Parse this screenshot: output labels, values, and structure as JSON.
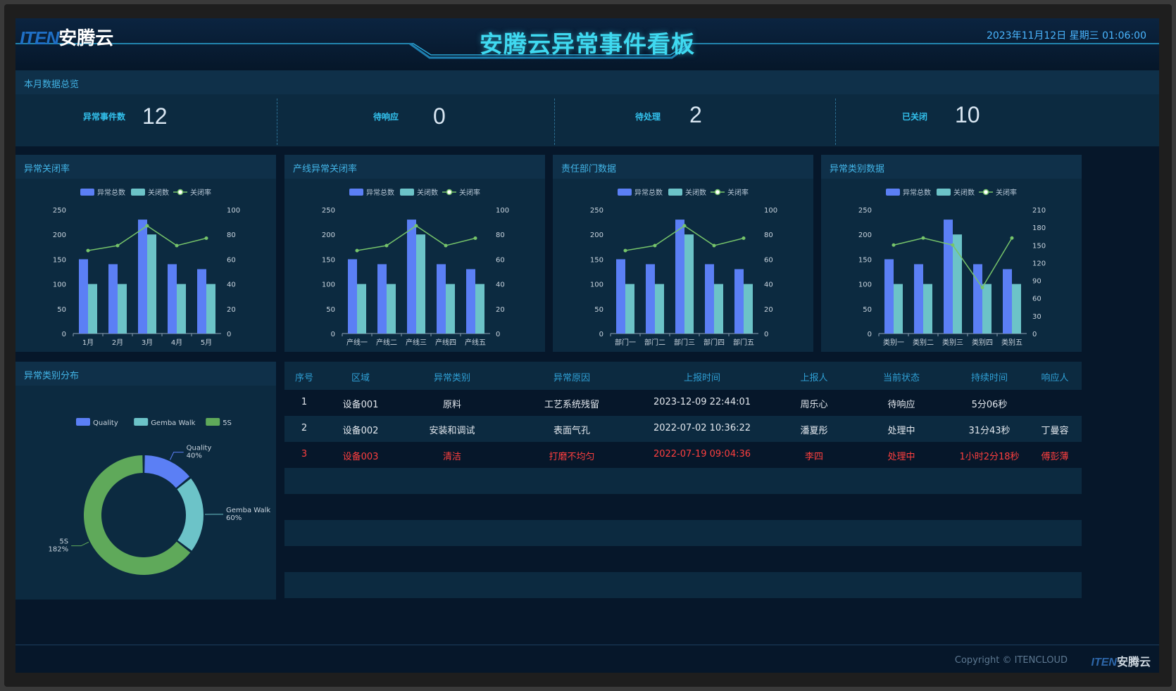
{
  "header": {
    "logo_mark": "ITEN",
    "logo_text": "安腾云",
    "title": "安腾云异常事件看板",
    "datetime": "2023年11月12日  星期三   01:06:00"
  },
  "overview": {
    "title": "本月数据总览",
    "kpis": [
      {
        "label": "异常事件数",
        "value": "12"
      },
      {
        "label": "待响应",
        "value": "0"
      },
      {
        "label": "待处理",
        "value": "2"
      },
      {
        "label": "已关闭",
        "value": "10"
      }
    ]
  },
  "legend_labels": {
    "total": "异常总数",
    "closed": "关闭数",
    "rate": "关闭率"
  },
  "colors": {
    "total": "#5b7ff5",
    "closed": "#6cc3c8",
    "rate": "#76c46a",
    "accent": "#3fd9f0",
    "alert": "#ff3f3f"
  },
  "chart_data": [
    {
      "panel_title": "异常关闭率",
      "type": "bar",
      "categories": [
        "1月",
        "2月",
        "3月",
        "4月",
        "5月"
      ],
      "series": [
        {
          "name": "异常总数",
          "type": "bar",
          "values": [
            150,
            140,
            230,
            140,
            130
          ]
        },
        {
          "name": "关闭数",
          "type": "bar",
          "values": [
            100,
            100,
            200,
            100,
            100
          ]
        },
        {
          "name": "关闭率",
          "type": "line",
          "axis": "right",
          "values": [
            67,
            71,
            87,
            71,
            77
          ]
        }
      ],
      "y_left_ticks": [
        0,
        50,
        100,
        150,
        200,
        250
      ],
      "y_right_ticks": [
        0,
        20,
        40,
        60,
        80,
        100
      ],
      "ylim_left": [
        0,
        250
      ],
      "ylim_right": [
        0,
        100
      ]
    },
    {
      "panel_title": "产线异常关闭率",
      "type": "bar",
      "categories": [
        "产线一",
        "产线二",
        "产线三",
        "产线四",
        "产线五"
      ],
      "series": [
        {
          "name": "异常总数",
          "type": "bar",
          "values": [
            150,
            140,
            230,
            140,
            130
          ]
        },
        {
          "name": "关闭数",
          "type": "bar",
          "values": [
            100,
            100,
            200,
            100,
            100
          ]
        },
        {
          "name": "关闭率",
          "type": "line",
          "axis": "right",
          "values": [
            67,
            71,
            87,
            71,
            77
          ]
        }
      ],
      "y_left_ticks": [
        0,
        50,
        100,
        150,
        200,
        250
      ],
      "y_right_ticks": [
        0,
        20,
        40,
        60,
        80,
        100
      ],
      "ylim_left": [
        0,
        250
      ],
      "ylim_right": [
        0,
        100
      ]
    },
    {
      "panel_title": "责任部门数据",
      "type": "bar",
      "categories": [
        "部门一",
        "部门二",
        "部门三",
        "部门四",
        "部门五"
      ],
      "series": [
        {
          "name": "异常总数",
          "type": "bar",
          "values": [
            150,
            140,
            230,
            140,
            130
          ]
        },
        {
          "name": "关闭数",
          "type": "bar",
          "values": [
            100,
            100,
            200,
            100,
            100
          ]
        },
        {
          "name": "关闭率",
          "type": "line",
          "axis": "right",
          "values": [
            67,
            71,
            87,
            71,
            77
          ]
        }
      ],
      "y_left_ticks": [
        0,
        50,
        100,
        150,
        200,
        250
      ],
      "y_right_ticks": [
        0,
        20,
        40,
        60,
        80,
        100
      ],
      "ylim_left": [
        0,
        250
      ],
      "ylim_right": [
        0,
        100
      ]
    },
    {
      "panel_title": "异常类别数据",
      "type": "bar",
      "categories": [
        "类别一",
        "类别二",
        "类别三",
        "类别四",
        "类别五"
      ],
      "series": [
        {
          "name": "异常总数",
          "type": "bar",
          "values": [
            150,
            140,
            230,
            140,
            130
          ]
        },
        {
          "name": "关闭数",
          "type": "bar",
          "values": [
            100,
            100,
            200,
            100,
            100
          ]
        },
        {
          "name": "关闭率",
          "type": "line",
          "axis": "right",
          "values": [
            150,
            162,
            150,
            78,
            162
          ]
        }
      ],
      "y_left_ticks": [
        0,
        50,
        100,
        150,
        200,
        250
      ],
      "y_right_ticks": [
        0,
        30,
        60,
        90,
        120,
        150,
        180,
        210
      ],
      "ylim_left": [
        0,
        250
      ],
      "ylim_right": [
        0,
        210
      ]
    },
    {
      "panel_title": "异常类别分布",
      "type": "pie",
      "slices": [
        {
          "name": "Quality",
          "value": 40,
          "label": "40%",
          "color": "#5b7ff5"
        },
        {
          "name": "Gemba Walk",
          "value": 60,
          "label": "60%",
          "color": "#6cc3c8"
        },
        {
          "name": "5S",
          "value": 182,
          "label": "182%",
          "color": "#5fa95a"
        }
      ]
    }
  ],
  "table": {
    "headers": [
      "序号",
      "区域",
      "异常类别",
      "异常原因",
      "上报时间",
      "上报人",
      "当前状态",
      "持续时间",
      "响应人"
    ],
    "rows": [
      {
        "alert": false,
        "cells": [
          "1",
          "设备001",
          "原料",
          "工艺系统残留",
          "2023-12-09 22:44:01",
          "周乐心",
          "待响应",
          "5分06秒",
          ""
        ]
      },
      {
        "alert": false,
        "cells": [
          "2",
          "设备002",
          "安装和调试",
          "表面气孔",
          "2022-07-02 10:36:22",
          "潘夏彤",
          "处理中",
          "31分43秒",
          "丁曼容"
        ]
      },
      {
        "alert": true,
        "cells": [
          "3",
          "设备003",
          "清洁",
          "打磨不均匀",
          "2022-07-19 09:04:36",
          "李四",
          "处理中",
          "1小时2分18秒",
          "傅彭薄"
        ]
      }
    ]
  },
  "footer": {
    "copyright": "Copyright © ITENCLOUD",
    "logo_mark": "ITEN",
    "logo_text": "安腾云"
  }
}
